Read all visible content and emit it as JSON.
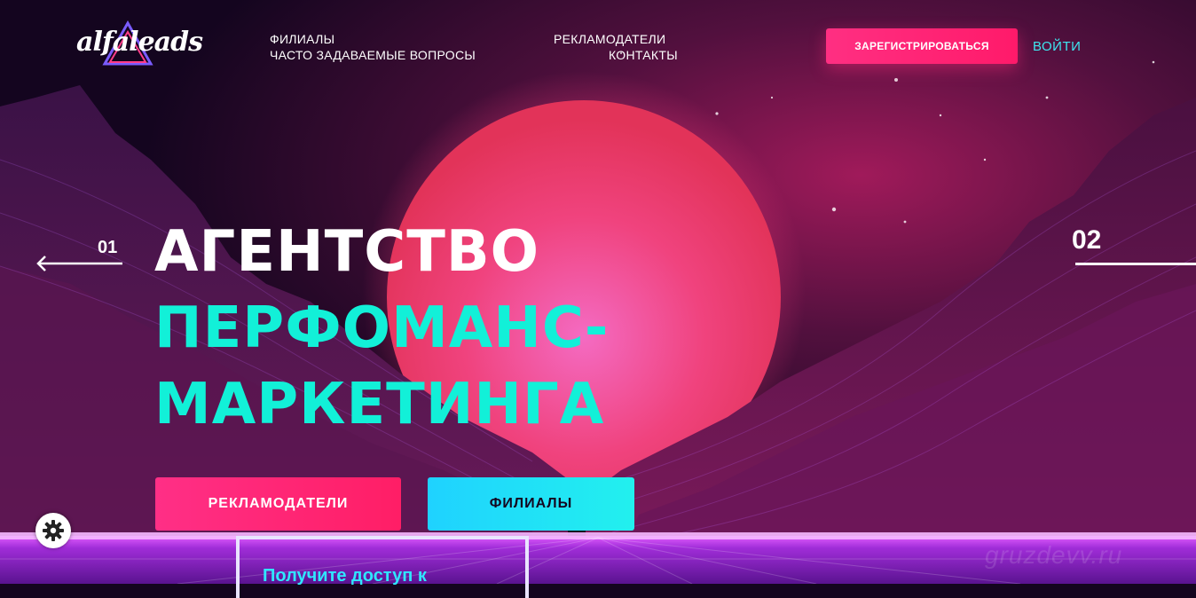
{
  "brand": {
    "logo_text": "alfaleads"
  },
  "nav": {
    "items": [
      {
        "label": "ФИЛИАЛЫ"
      },
      {
        "label": "ЧАСТО ЗАДАВАЕМЫЕ ВОПРОСЫ"
      },
      {
        "label": "РЕКЛАМОДАТЕЛИ"
      },
      {
        "label": "КОНТАКТЫ"
      }
    ],
    "register_label": "ЗАРЕГИСТРИРОВАТЬСЯ",
    "login_label": "ВОЙТИ"
  },
  "slider": {
    "prev_num": "01",
    "next_num": "02"
  },
  "hero": {
    "line1": "АГЕНТСТВО",
    "line2": "ПЕРФОМАНС-",
    "line3": "МАРКЕТИНГА"
  },
  "cta": {
    "advertisers_label": "РЕКЛАМОДАТЕЛИ",
    "affiliates_label": "ФИЛИАЛЫ"
  },
  "access": {
    "text": "Получите доступ к"
  },
  "watermark": "gruzdevv.ru",
  "colors": {
    "accent_pink": "#ff2f82",
    "accent_teal": "#12f0d8",
    "login_cyan": "#3ee6f0",
    "background": "#14051f"
  }
}
